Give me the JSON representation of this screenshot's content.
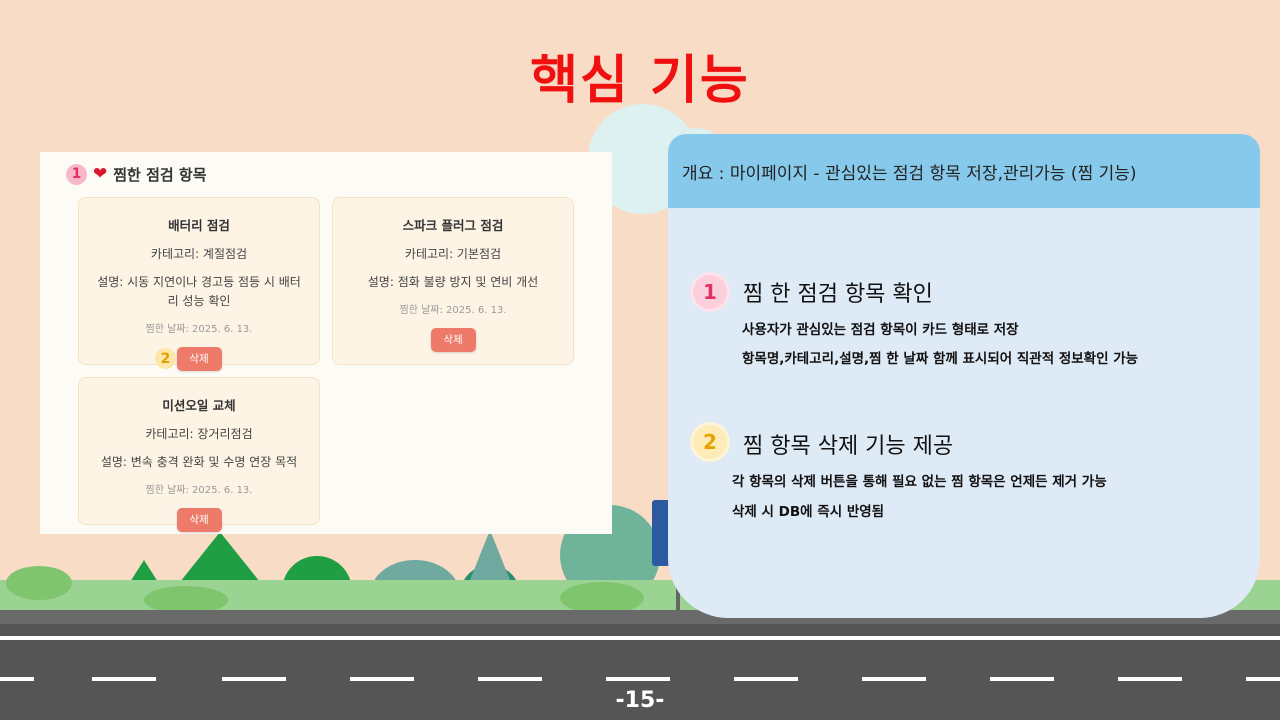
{
  "slide": {
    "title": "핵심 기능",
    "page_number": "-15-"
  },
  "screenshot": {
    "header_number": "1",
    "header_icon": "heart-icon",
    "header_title": "찜한 점검 항목",
    "delete_badge_number": "2",
    "cards": [
      {
        "name": "배터리 점검",
        "category": "카테고리: 계절점검",
        "description": "설명: 시동 지연이나 경고등 점등 시 배터리 성능 확인",
        "date": "찜한 날짜: 2025. 6. 13.",
        "button": "삭제"
      },
      {
        "name": "스파크 플러그 점검",
        "category": "카테고리: 기본점검",
        "description": "설명: 점화 불량 방지 및 연비 개선",
        "date": "찜한 날짜: 2025. 6. 13.",
        "button": "삭제"
      },
      {
        "name": "미션오일 교체",
        "category": "카테고리: 장거리점검",
        "description": "설명: 변속 충격 완화 및 수명 연장 목적",
        "date": "찜한 날짜: 2025. 6. 13.",
        "button": "삭제"
      }
    ]
  },
  "info": {
    "overview": "개요 : 마이페이지 - 관심있는 점검 항목 저장,관리가능 (찜 기능)",
    "sections": [
      {
        "number": "1",
        "title": "찜 한 점검 항목 확인",
        "lines": [
          "사용자가 관심있는 점검 항목이 카드 형태로 저장",
          "항목명,카테고리,설명,찜 한 날짜 함께 표시되어 직관적 정보확인 가능"
        ]
      },
      {
        "number": "2",
        "title": "찜 항목 삭제 기능 제공",
        "lines": [
          "각 항목의 삭제 버튼을 통해 필요 없는 찜 항목은 언제든 제거 가능",
          "삭제 시 DB에 즉시 반영됨"
        ]
      }
    ]
  },
  "colors": {
    "background": "#f9dcc6",
    "title": "#f01010",
    "info_header": "#87c9ea",
    "info_body": "#dfeaf7",
    "delete_button": "#ee7a6a"
  }
}
